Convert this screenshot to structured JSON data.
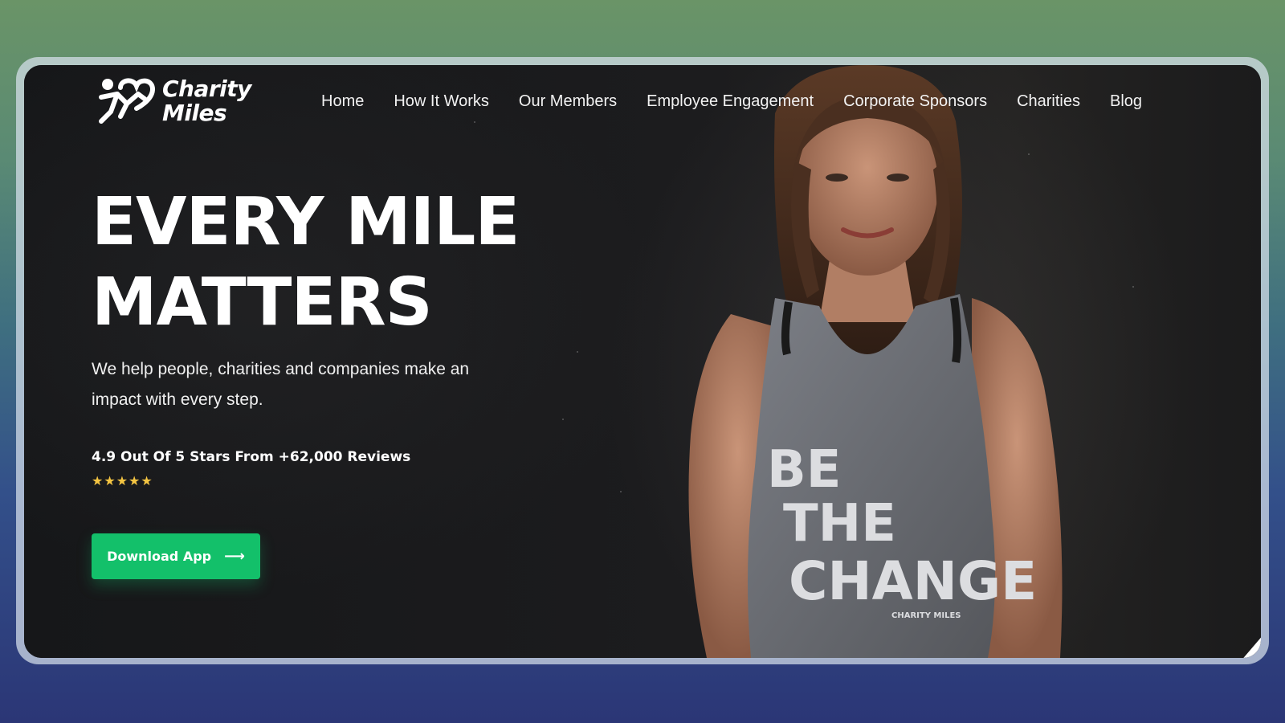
{
  "brand": {
    "name_line1": "Charity",
    "name_line2": "Miles",
    "icon": "runner-heart-logo-icon"
  },
  "nav": {
    "items": [
      {
        "label": "Home"
      },
      {
        "label": "How It Works"
      },
      {
        "label": "Our Members"
      },
      {
        "label": "Employee Engagement"
      },
      {
        "label": "Corporate Sponsors"
      },
      {
        "label": "Charities"
      },
      {
        "label": "Blog"
      }
    ]
  },
  "hero": {
    "title_line1": "EVERY MILE",
    "title_line2": "MATTERS",
    "subtitle": "We help people, charities and companies make an impact with every step.",
    "rating_text": "4.9 Out Of 5 Stars From +62,000 Reviews",
    "stars": "★★★★★",
    "rating_value": 4.9,
    "rating_max": 5,
    "cta_label": "Download App",
    "cta_icon": "arrow-right-icon"
  },
  "shirt": {
    "line1": "BE",
    "line2": "THE",
    "line3": "CHANGE",
    "tag": "CHARITY MILES"
  },
  "colors": {
    "accent": "#13c06a",
    "star": "#f5c542",
    "background": "#141517"
  }
}
